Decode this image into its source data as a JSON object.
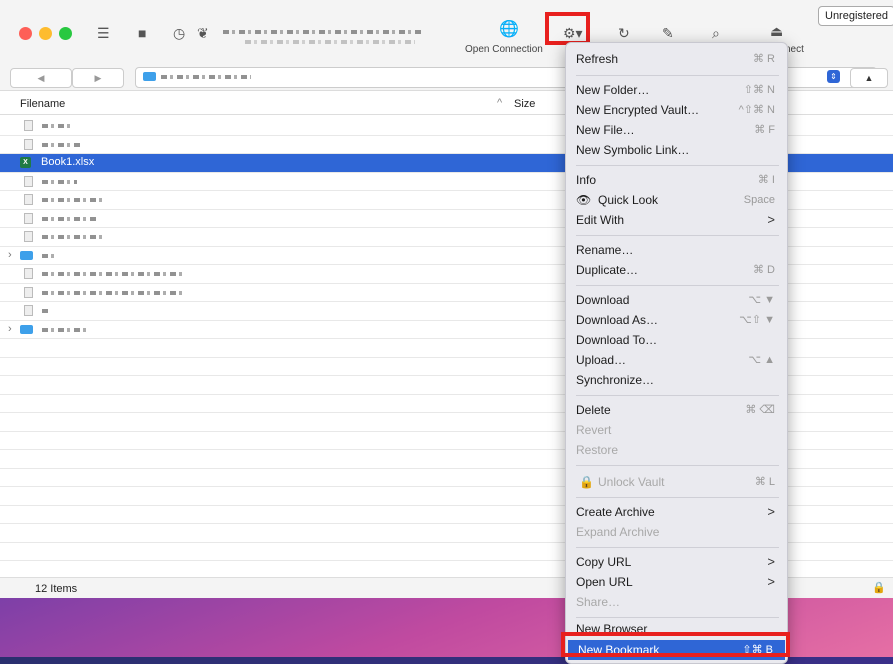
{
  "toolbar": {
    "open_connection_label": "Open Connection",
    "disconnect_label": "nect",
    "unregistered_label": "Unregistered"
  },
  "browser": {
    "columns": {
      "filename": "Filename",
      "size": "Size"
    },
    "selected_file": "Book1.xlsx",
    "status": "12 Items"
  },
  "menu": {
    "items": [
      {
        "label": "Refresh",
        "shortcut": "⌘ R"
      },
      {
        "label": "New Folder…",
        "shortcut": "⇧⌘ N"
      },
      {
        "label": "New Encrypted Vault…",
        "shortcut": "^⇧⌘ N"
      },
      {
        "label": "New File…",
        "shortcut": "⌘ F"
      },
      {
        "label": "New Symbolic Link…",
        "shortcut": ""
      },
      {
        "label": "Info",
        "shortcut": "⌘ I"
      },
      {
        "label": "Quick Look",
        "shortcut": "Space"
      },
      {
        "label": "Edit With",
        "shortcut": ">"
      },
      {
        "label": "Rename…",
        "shortcut": ""
      },
      {
        "label": "Duplicate…",
        "shortcut": "⌘ D"
      },
      {
        "label": "Download",
        "shortcut": "⌥ ▼"
      },
      {
        "label": "Download As…",
        "shortcut": "⌥⇧ ▼"
      },
      {
        "label": "Download To…",
        "shortcut": ""
      },
      {
        "label": "Upload…",
        "shortcut": "⌥ ▲"
      },
      {
        "label": "Synchronize…",
        "shortcut": ""
      },
      {
        "label": "Delete",
        "shortcut": "⌘ ⌫"
      },
      {
        "label": "Revert",
        "shortcut": ""
      },
      {
        "label": "Restore",
        "shortcut": ""
      },
      {
        "label": "Unlock Vault",
        "shortcut": "⌘ L"
      },
      {
        "label": "Create Archive",
        "shortcut": ">"
      },
      {
        "label": "Expand Archive",
        "shortcut": ""
      },
      {
        "label": "Copy URL",
        "shortcut": ">"
      },
      {
        "label": "Open URL",
        "shortcut": ">"
      },
      {
        "label": "Share…",
        "shortcut": ""
      },
      {
        "label": "New Browser",
        "shortcut": ""
      },
      {
        "label": "New Bookmark",
        "shortcut": "⇧⌘ B"
      }
    ]
  },
  "colors": {
    "accent": "#2f66d6",
    "highlight_box": "#e8201e",
    "folder": "#3ea0ea"
  }
}
